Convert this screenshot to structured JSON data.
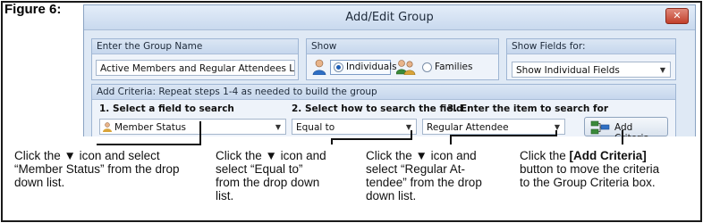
{
  "figure_label": "Figure 6:",
  "window": {
    "title": "Add/Edit Group",
    "close_glyph": "✕"
  },
  "group_name": {
    "header": "Enter the Group Name",
    "value": "Active Members and Regular Attendees List"
  },
  "show": {
    "header": "Show",
    "options": [
      {
        "label": "Individuals",
        "selected": true,
        "icon": "single-person-icon"
      },
      {
        "label": "Families",
        "selected": false,
        "icon": "family-icon"
      }
    ]
  },
  "show_fields": {
    "header": "Show Fields for:",
    "value": "Show Individual Fields"
  },
  "criteria": {
    "header": "Add Criteria: Repeat steps 1-4 as needed to build the group",
    "step1": "1. Select a field to search",
    "step2": "2. Select how to search the field",
    "step3": "3. Enter the item to search for",
    "field_value": "Member Status",
    "operator_value": "Equal to",
    "item_value": "Regular Attendee",
    "add_button": "Add Criteria",
    "dropdown_glyph": "▼"
  },
  "callouts": {
    "c1": {
      "line1": "Click the ▼ icon and select",
      "line2": "“Member Status” from the drop",
      "line3": "down list."
    },
    "c2": {
      "line1": "Click the ▼ icon and",
      "line2": "select “Equal to”",
      "line3": "from the drop down",
      "line4": "list."
    },
    "c3": {
      "line1": "Click the ▼ icon and",
      "line2": "select “Regular At-",
      "line3": "tendee” from the drop",
      "line4": "down list."
    },
    "c4": {
      "line1_pre": "Click the ",
      "line1_bold": "[Add Criteria]",
      "line2": "button to move the criteria",
      "line3": "to the Group Criteria box."
    }
  },
  "colors": {
    "window_bg": "#dfe9f5",
    "group_header": "#c6d7ed",
    "border": "#9fb6d4",
    "close_red": "#c2402c",
    "radio_selected": "#1f5fb6"
  }
}
